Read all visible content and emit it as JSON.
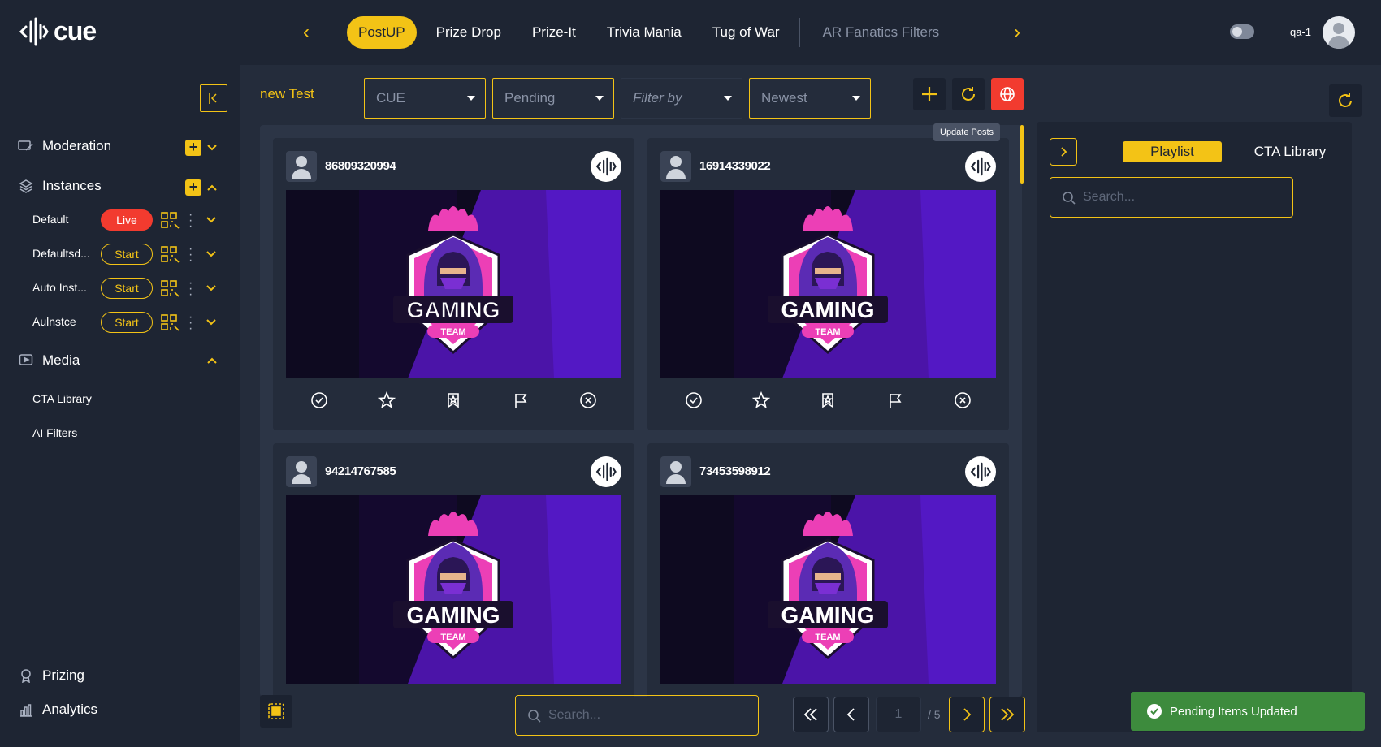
{
  "app": {
    "logo_text": "cue"
  },
  "nav": {
    "tabs": [
      {
        "label": "PostUP",
        "active": true
      },
      {
        "label": "Prize Drop",
        "active": false
      },
      {
        "label": "Prize-It",
        "active": false
      },
      {
        "label": "Trivia Mania",
        "active": false
      },
      {
        "label": "Tug of War",
        "active": false
      },
      {
        "label": "AR Fanatics Filters",
        "active": false
      }
    ]
  },
  "user": {
    "name": "qa-1"
  },
  "sidebar": {
    "moderation_label": "Moderation",
    "instances_label": "Instances",
    "instances": [
      {
        "name": "Default",
        "status": "Live"
      },
      {
        "name": "Defaultsd...",
        "status": "Start"
      },
      {
        "name": "Auto Inst...",
        "status": "Start"
      },
      {
        "name": "Aulnstce",
        "status": "Start"
      }
    ],
    "media_label": "Media",
    "media_items": [
      "CTA Library",
      "AI Filters"
    ],
    "prizing_label": "Prizing",
    "analytics_label": "Analytics"
  },
  "filters": {
    "title": "new Test",
    "source": "CUE",
    "status": "Pending",
    "filter_by": "Filter by",
    "sort": "Newest",
    "tooltip": "Update Posts"
  },
  "posts": [
    {
      "id": "86809320994",
      "image": "GAMING TEAM logo"
    },
    {
      "id": "16914339022",
      "image": "GAMING TEAM logo"
    },
    {
      "id": "94214767585",
      "image": "GAMING TEAM logo"
    },
    {
      "id": "73453598912",
      "image": "GAMING TEAM logo"
    }
  ],
  "logo_card": {
    "line1": "GAMING",
    "line2": "TEAM"
  },
  "pagination": {
    "search_placeholder": "Search...",
    "current_page": "1",
    "total": "/ 5"
  },
  "right_panel": {
    "tabs": [
      {
        "label": "Playlist",
        "active": true
      },
      {
        "label": "CTA Library",
        "active": false
      }
    ],
    "search_placeholder": "Search..."
  },
  "toast": {
    "message": "Pending Items Updated"
  },
  "colors": {
    "accent": "#f3c316",
    "live": "#f23b2f",
    "success": "#3d8b3d",
    "bg": "#1e2533"
  }
}
